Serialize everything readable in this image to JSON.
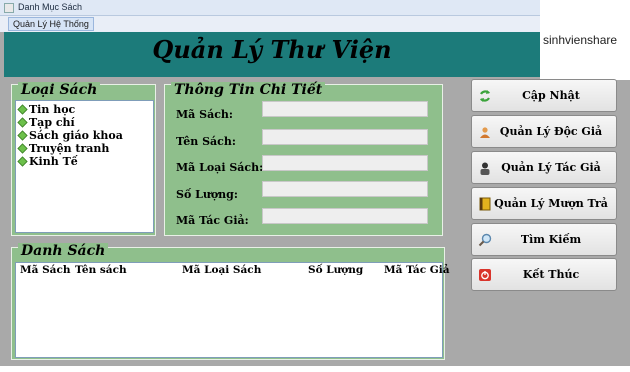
{
  "window": {
    "title": "Danh Mục Sách",
    "menu": [
      "Quản Lý Hệ Thống"
    ],
    "watermark": "sinhvienshare"
  },
  "header": {
    "title": "Quản Lý Thư Viện"
  },
  "loai_sach": {
    "caption": "Loại Sách",
    "items": [
      "Tin học",
      "Tạp chí",
      "Sách giáo khoa",
      "Truyện tranh",
      "Kinh Tế"
    ]
  },
  "thong_tin": {
    "caption": "Thông Tin Chi  Tiết",
    "fields": [
      {
        "label": "Mã Sách:",
        "value": ""
      },
      {
        "label": "Tên Sách:",
        "value": ""
      },
      {
        "label": "Mã Loại Sách:",
        "value": ""
      },
      {
        "label": "Số Lượng:",
        "value": ""
      },
      {
        "label": "Mã Tác Giả:",
        "value": ""
      }
    ]
  },
  "danh_sach": {
    "caption": "Danh Sách",
    "columns": [
      "Mã Sách",
      "Tên sách",
      "Mã Loại Sách",
      "Số Lượng",
      "Mã Tác Giả"
    ]
  },
  "buttons": [
    {
      "label": "Cập Nhật",
      "icon": "refresh-icon"
    },
    {
      "label": "Quản Lý Độc Giả",
      "icon": "reader-icon"
    },
    {
      "label": "Quản Lý Tác Giả",
      "icon": "author-icon"
    },
    {
      "label": "Quản Lý Mượn Trả",
      "icon": "book-icon"
    },
    {
      "label": "Tìm Kiếm",
      "icon": "magnifier-icon"
    },
    {
      "label": "Kết Thúc",
      "icon": "power-icon"
    }
  ]
}
